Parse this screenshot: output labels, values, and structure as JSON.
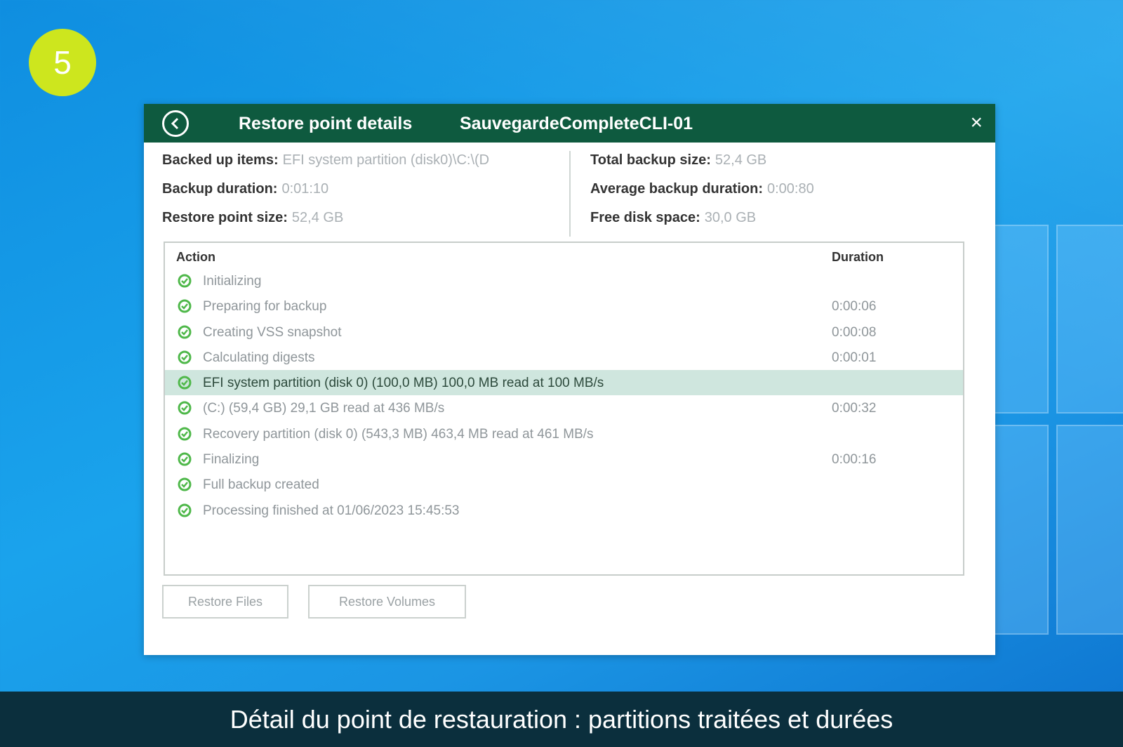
{
  "step_number": "5",
  "dialog": {
    "title": "Restore point details",
    "job_name": "SauvegardeCompleteCLI-01",
    "close_label": "×"
  },
  "stats": {
    "left": [
      {
        "label": "Backed up items:",
        "value": "EFI system partition (disk0)\\C:\\(D"
      },
      {
        "label": "Backup duration:",
        "value": "0:01:10"
      },
      {
        "label": "Restore point size:",
        "value": "52,4 GB"
      }
    ],
    "right": [
      {
        "label": "Total backup size:",
        "value": "52,4 GB"
      },
      {
        "label": "Average backup duration:",
        "value": "0:00:80"
      },
      {
        "label": "Free disk space:",
        "value": "30,0 GB"
      }
    ]
  },
  "log": {
    "header_action": "Action",
    "header_duration": "Duration",
    "rows": [
      {
        "text": "Initializing",
        "duration": ""
      },
      {
        "text": "Preparing for backup",
        "duration": "0:00:06"
      },
      {
        "text": "Creating VSS snapshot",
        "duration": "0:00:08"
      },
      {
        "text": "Calculating digests",
        "duration": "0:00:01"
      },
      {
        "text": "EFI system partition (disk 0) (100,0 MB) 100,0 MB read at 100 MB/s",
        "duration": ""
      },
      {
        "text": "(C:) (59,4 GB) 29,1 GB read at 436 MB/s",
        "duration": "0:00:32"
      },
      {
        "text": "Recovery partition (disk 0) (543,3 MB) 463,4 MB read at 461 MB/s",
        "duration": ""
      },
      {
        "text": "Finalizing",
        "duration": "0:00:16"
      },
      {
        "text": "Full backup created",
        "duration": ""
      },
      {
        "text": "Processing finished at 01/06/2023 15:45:53",
        "duration": ""
      }
    ],
    "selected_index": 4
  },
  "buttons": {
    "restore_files": "Restore Files",
    "restore_volumes": "Restore Volumes"
  },
  "caption": "Détail du point de restauration : partitions traitées et durées",
  "colors": {
    "titlebar": "#0e5a3f",
    "check": "#4fb84a",
    "badge": "#cde61e",
    "caption_bar": "#0b2f3d"
  }
}
